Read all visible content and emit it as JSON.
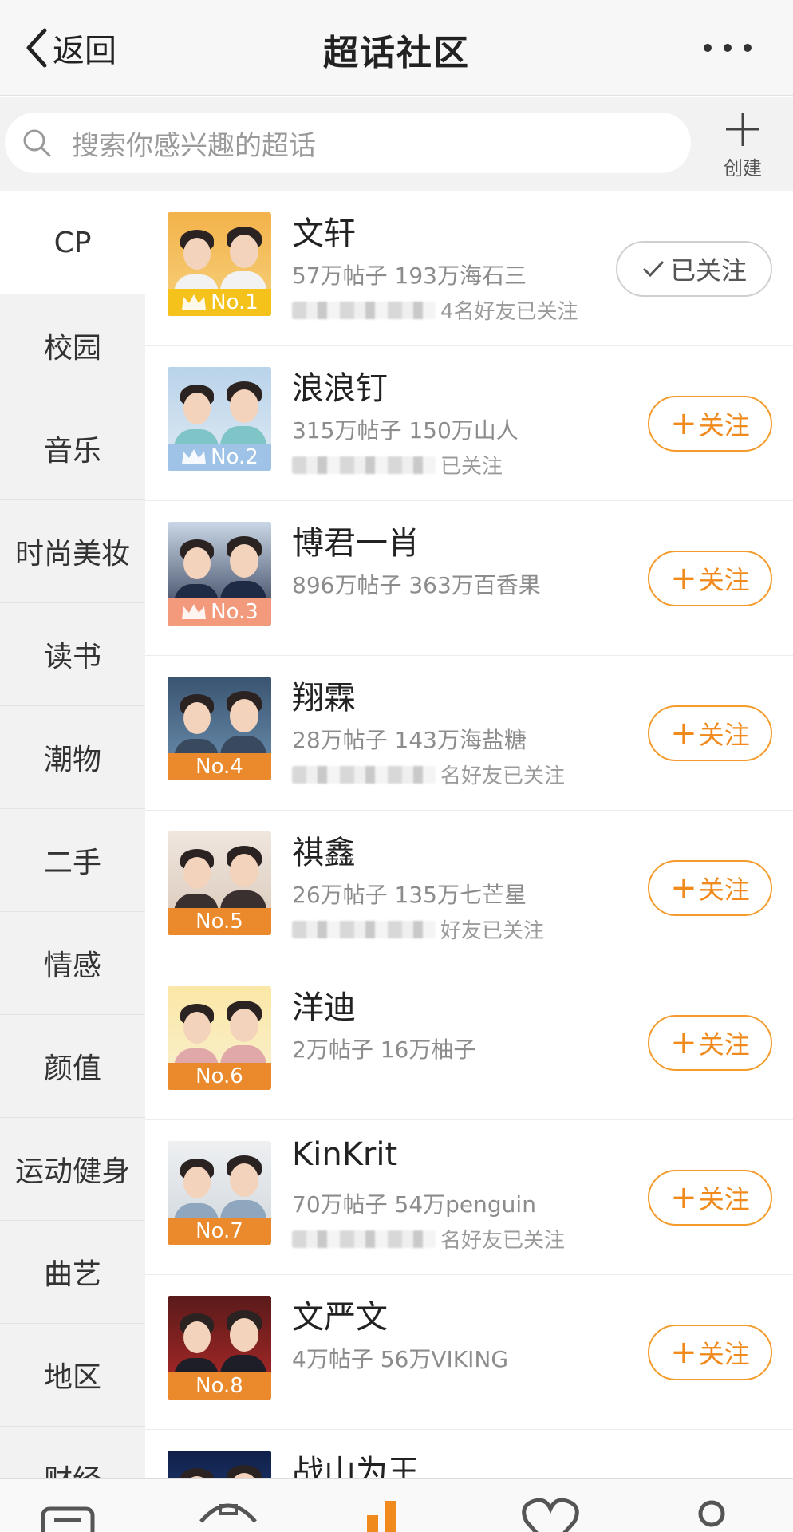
{
  "header": {
    "back_label": "返回",
    "title": "超话社区"
  },
  "search": {
    "placeholder": "搜索你感兴趣的超话",
    "create_label": "创建"
  },
  "sidebar": {
    "items": [
      {
        "label": "CP",
        "active": true
      },
      {
        "label": "校园"
      },
      {
        "label": "音乐"
      },
      {
        "label": "时尚美妆"
      },
      {
        "label": "读书"
      },
      {
        "label": "潮物"
      },
      {
        "label": "二手"
      },
      {
        "label": "情感"
      },
      {
        "label": "颜值"
      },
      {
        "label": "运动健身"
      },
      {
        "label": "曲艺"
      },
      {
        "label": "地区"
      },
      {
        "label": "财经"
      }
    ]
  },
  "list": {
    "items": [
      {
        "rank": "No.1",
        "name": "文轩",
        "stats": "57万帖子 193万海石三",
        "friends": "4名好友已关注",
        "followed": true,
        "button": "已关注",
        "rank_color": "#f5c21b",
        "crown": true
      },
      {
        "rank": "No.2",
        "name": "浪浪钉",
        "stats": "315万帖子 150万山人",
        "friends": "已关注",
        "followed": false,
        "button": "关注",
        "rank_color": "#9fc3e6",
        "crown": true
      },
      {
        "rank": "No.3",
        "name": "博君一肖",
        "stats": "896万帖子 363万百香果",
        "friends": "",
        "followed": false,
        "button": "关注",
        "rank_color": "#f39a7c",
        "crown": true
      },
      {
        "rank": "No.4",
        "name": "翔霖",
        "stats": "28万帖子 143万海盐糖",
        "friends": "名好友已关注",
        "followed": false,
        "button": "关注",
        "rank_color": "#ea8a2c",
        "crown": false
      },
      {
        "rank": "No.5",
        "name": "祺鑫",
        "stats": "26万帖子 135万七芒星",
        "friends": "好友已关注",
        "followed": false,
        "button": "关注",
        "rank_color": "#ea8a2c",
        "crown": false
      },
      {
        "rank": "No.6",
        "name": "洋迪",
        "stats": "2万帖子 16万柚子",
        "friends": "",
        "followed": false,
        "button": "关注",
        "rank_color": "#ea8a2c",
        "crown": false
      },
      {
        "rank": "No.7",
        "name": "KinKrit",
        "stats": "70万帖子 54万penguin",
        "friends": "名好友已关注",
        "followed": false,
        "button": "关注",
        "rank_color": "#ea8a2c",
        "crown": false
      },
      {
        "rank": "No.8",
        "name": "文严文",
        "stats": "4万帖子 56万VIKING",
        "friends": "",
        "followed": false,
        "button": "关注",
        "rank_color": "#ea8a2c",
        "crown": false
      },
      {
        "rank": "",
        "name": "战山为王",
        "stats": "",
        "friends": "",
        "followed": false,
        "button": "",
        "rank_color": "#ea8a2c",
        "crown": false
      }
    ]
  },
  "colors": {
    "accent": "#f08a1c",
    "header_bg": "#f7f7f7",
    "sidebar_bg": "#f2f2f2"
  }
}
